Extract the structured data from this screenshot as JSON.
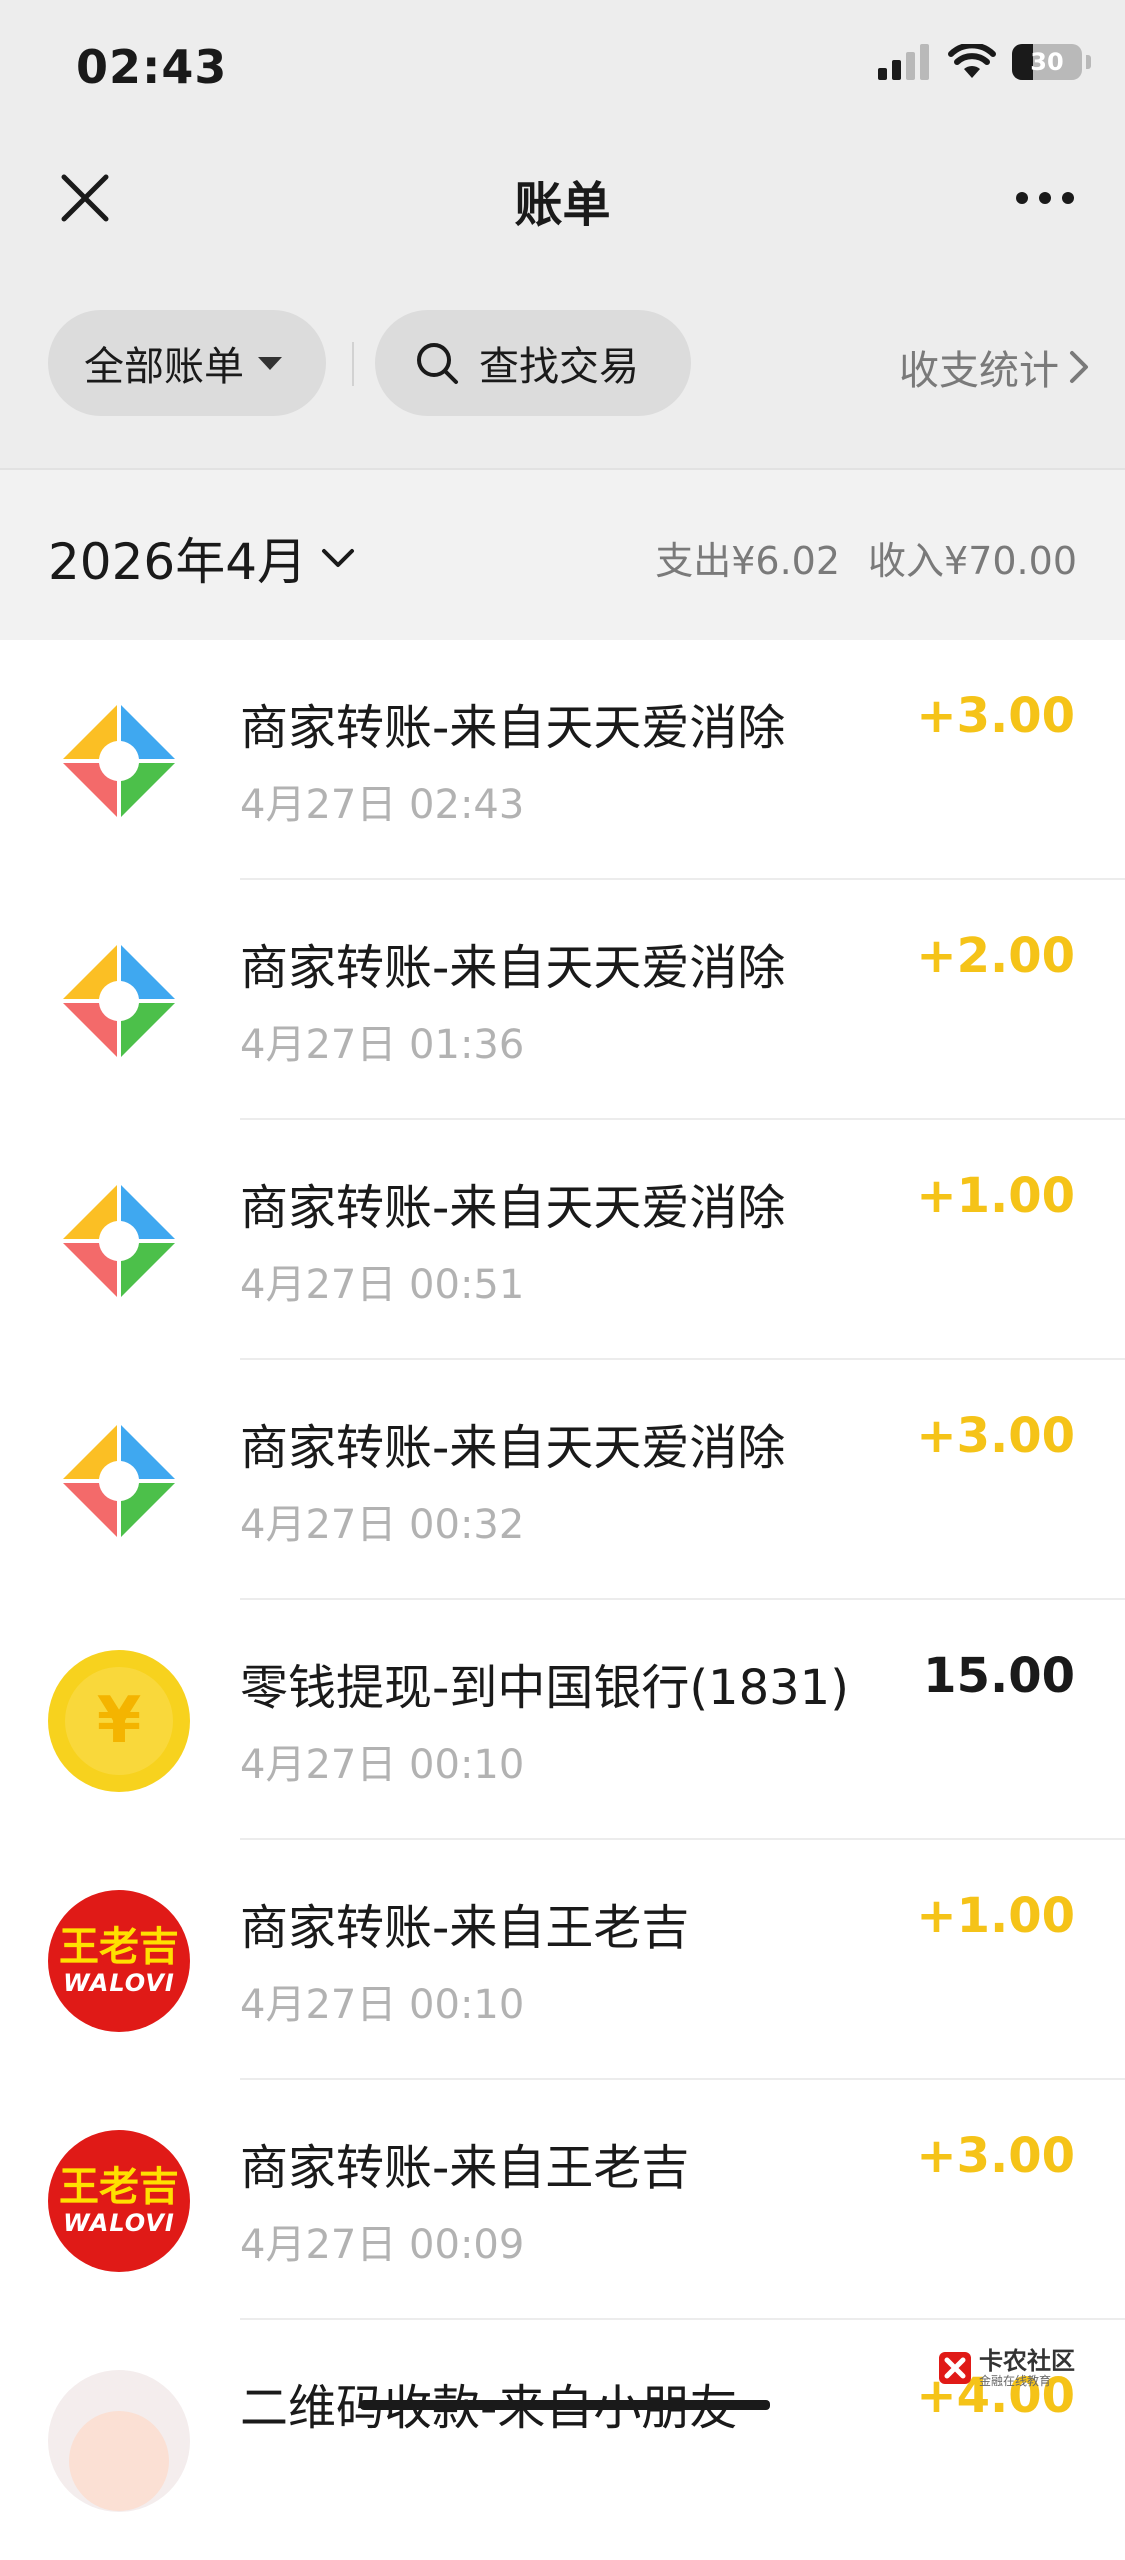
{
  "status_bar": {
    "time": "02:43",
    "battery": "30",
    "battery_level": 0.3
  },
  "nav": {
    "title": "账单"
  },
  "filters": {
    "all_bills": "全部账单",
    "search": "查找交易",
    "stats": "收支统计"
  },
  "month": {
    "label": "2026年4月",
    "expense": "支出¥6.02",
    "income": "收入¥70.00"
  },
  "transactions": [
    {
      "title": "商家转账-来自天天爱消除",
      "time": "4月27日 02:43",
      "amount": "+3.00",
      "icon": "game-app-icon"
    },
    {
      "title": "商家转账-来自天天爱消除",
      "time": "4月27日 01:36",
      "amount": "+2.00",
      "icon": "game-app-icon"
    },
    {
      "title": "商家转账-来自天天爱消除",
      "time": "4月27日 00:51",
      "amount": "+1.00",
      "icon": "game-app-icon"
    },
    {
      "title": "商家转账-来自天天爱消除",
      "time": "4月27日 00:32",
      "amount": "+3.00",
      "icon": "game-app-icon"
    },
    {
      "title": "零钱提现-到中国银行(1831)",
      "time": "4月27日 00:10",
      "amount": "15.00",
      "icon": "yuan-coin-icon"
    },
    {
      "title": "商家转账-来自王老吉",
      "time": "4月27日 00:10",
      "amount": "+1.00",
      "icon": "walovi-logo"
    },
    {
      "title": "商家转账-来自王老吉",
      "time": "4月27日 00:09",
      "amount": "+3.00",
      "icon": "walovi-logo"
    },
    {
      "title": "二维码收款-来自小朋友",
      "amount": "+4.00",
      "icon": "avatar"
    }
  ],
  "logos": {
    "walovi_cn": "王老吉",
    "walovi_en": "WALOVI",
    "yuan_symbol": "¥"
  },
  "watermark": {
    "main": "卡农社区",
    "sub": "金融在线教育"
  },
  "colors": {
    "income": "#f5c318",
    "background_top": "#ededed",
    "text_muted": "#b2b2b2"
  }
}
